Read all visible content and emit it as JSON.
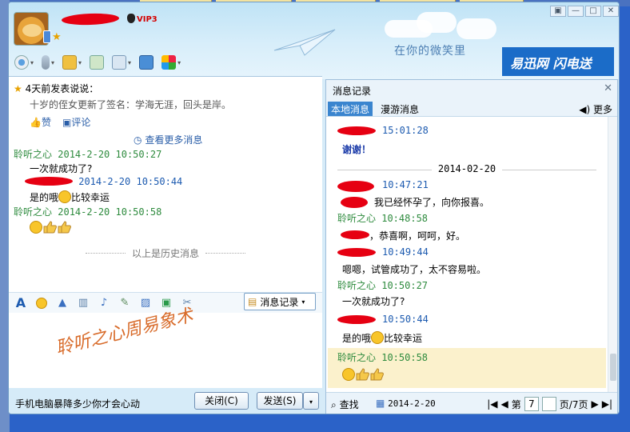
{
  "window": {
    "vip": "VIP3",
    "slogan": "在你的微笑里",
    "brand": "易迅网 闪电送"
  },
  "mood": {
    "header": "4天前发表说说：",
    "text": "十岁的侄女更新了签名：学海无涯，回头是岸。",
    "like": "赞",
    "comment": "评论"
  },
  "chat": {
    "view_more": "查看更多消息",
    "messages": [
      {
        "sender": "聆听之心",
        "time": "2014-2-20 10:50:27",
        "text": "一次就成功了?"
      },
      {
        "sender": "",
        "time": "2014-2-20 10:50:44",
        "text": "是的哦",
        "tail": "比较幸运"
      },
      {
        "sender": "聆听之心",
        "time": "2014-2-20 10:50:58",
        "text": ""
      }
    ],
    "history_sep": "以上是历史消息"
  },
  "input_toolbar": {
    "msg_record": "消息记录"
  },
  "watermark": "聆听之心周易象术",
  "bottom": {
    "ad": "手机电脑暴降多少你才会心动",
    "close": "关闭(C)",
    "send": "发送(S)"
  },
  "history": {
    "title": "消息记录",
    "tab_local": "本地消息",
    "tab_roam": "漫游消息",
    "more": "更多",
    "lines": [
      {
        "kind": "time",
        "value": "15:01:28"
      },
      {
        "kind": "text",
        "value": "谢谢！"
      },
      {
        "kind": "date",
        "value": "2014-02-20"
      },
      {
        "kind": "time",
        "value": "10:47:21"
      },
      {
        "kind": "text",
        "value": "我已经怀孕了，向你报喜。"
      },
      {
        "kind": "head",
        "value": "聆听之心 10:48:58"
      },
      {
        "kind": "text",
        "value": "，恭喜啊，呵呵，好。"
      },
      {
        "kind": "time",
        "value": "10:49:44"
      },
      {
        "kind": "text",
        "value": "嗯嗯，试管成功了，太不容易啦。"
      },
      {
        "kind": "head",
        "value": "聆听之心 10:50:27"
      },
      {
        "kind": "text",
        "value": "一次就成功了?"
      },
      {
        "kind": "time",
        "value": "10:50:44"
      },
      {
        "kind": "text",
        "value": "是的哦",
        "tail": "比较幸运"
      },
      {
        "kind": "head",
        "value": "聆听之心 10:50:58"
      }
    ],
    "find": "查找",
    "date": "2014-2-20",
    "page_prefix": "第",
    "page": "7",
    "page_suffix": "页/7页"
  },
  "colors": {
    "accent": "#3a85cf",
    "sender_green": "#2e8b3e",
    "time_blue": "#1d5bb0",
    "redaction": "#e60012"
  }
}
